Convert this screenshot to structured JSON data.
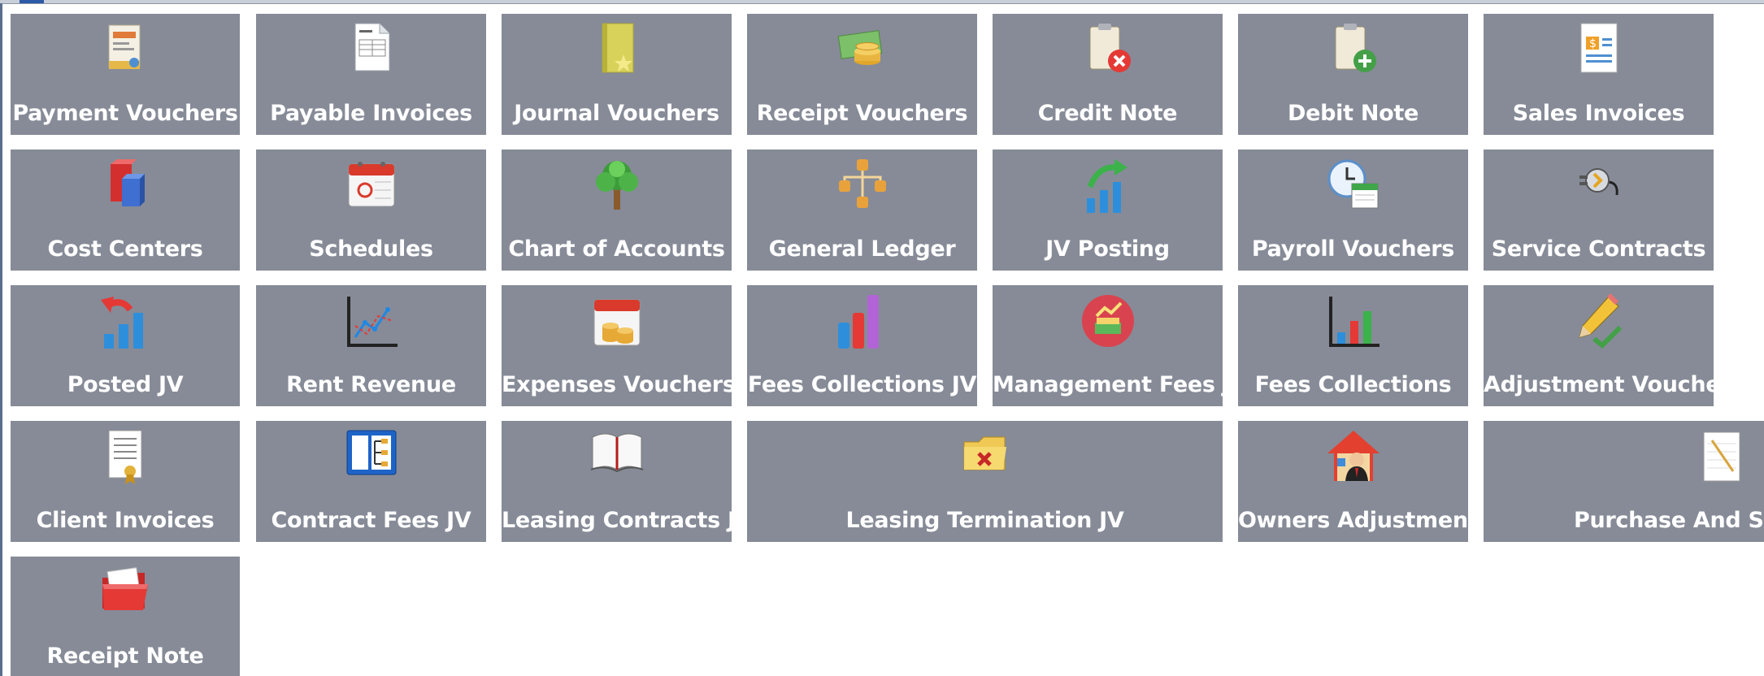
{
  "tiles": [
    {
      "label": "Payment Vouchers",
      "icon": "payment-voucher-icon"
    },
    {
      "label": "Payable Invoices",
      "icon": "invoice-document-icon"
    },
    {
      "label": "Journal Vouchers",
      "icon": "journal-book-icon"
    },
    {
      "label": "Receipt Vouchers",
      "icon": "money-coins-icon"
    },
    {
      "label": "Credit Note",
      "icon": "clipboard-remove-icon"
    },
    {
      "label": "Debit Note",
      "icon": "clipboard-add-icon"
    },
    {
      "label": "Sales Invoices",
      "icon": "sales-invoice-icon"
    },
    {
      "label": "Cost Centers",
      "icon": "cubes-icon"
    },
    {
      "label": "Schedules",
      "icon": "calendar-icon"
    },
    {
      "label": "Chart of Accounts",
      "icon": "tree-icon"
    },
    {
      "label": "General Ledger",
      "icon": "org-chart-icon"
    },
    {
      "label": "JV Posting",
      "icon": "bar-chart-arrow-icon"
    },
    {
      "label": "Payroll Vouchers",
      "icon": "clock-calendar-icon"
    },
    {
      "label": "Service Contracts",
      "icon": "plug-icon"
    },
    {
      "label": "Posted JV",
      "icon": "bar-chart-back-arrow-icon"
    },
    {
      "label": "Rent Revenue",
      "icon": "line-graph-icon"
    },
    {
      "label": "Expenses Vouchers",
      "icon": "calendar-coins-icon"
    },
    {
      "label": "Fees Collections JV",
      "icon": "colored-bars-icon"
    },
    {
      "label": "Management Fees JV",
      "icon": "money-growth-badge-icon"
    },
    {
      "label": "Fees Collections",
      "icon": "bar-chart-axes-icon"
    },
    {
      "label": "Adjustment Voucher",
      "icon": "pencil-check-icon"
    },
    {
      "label": "Client Invoices",
      "icon": "certificate-icon"
    },
    {
      "label": "Contract Fees JV",
      "icon": "structure-diagram-icon"
    },
    {
      "label": "Leasing Contracts JV",
      "icon": "open-book-icon"
    },
    {
      "label": "Leasing Termination JV",
      "icon": "folder-delete-icon"
    },
    {
      "label": "Owners Adjustment",
      "icon": "house-person-icon"
    },
    {
      "label": "Purchase And Store",
      "icon": "notepad-pencil-icon"
    },
    {
      "label": "Receipt Note",
      "icon": "red-folder-icon"
    }
  ],
  "colors": {
    "tile_bg": "#868b97",
    "label": "#ffffff",
    "background": "#ffffff"
  }
}
